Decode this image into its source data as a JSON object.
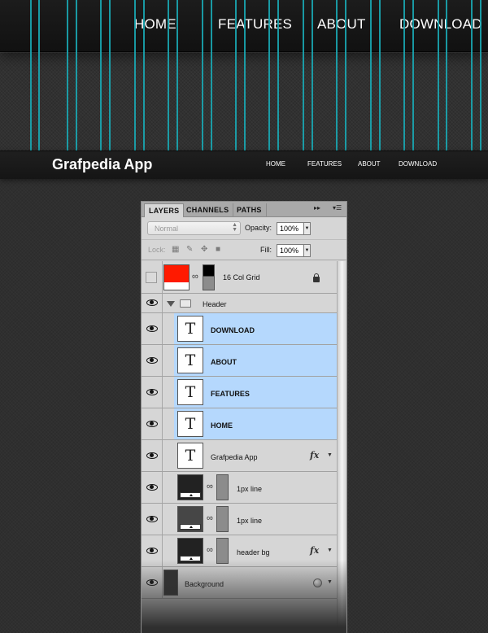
{
  "zoomed_header": {
    "nav": [
      "HOME",
      "FEATURES",
      "ABOUT",
      "DOWNLOAD"
    ],
    "grid_color": "#1aa7b2"
  },
  "site_header": {
    "logo": "Grafpedia App",
    "nav": [
      "HOME",
      "FEATURES",
      "ABOUT",
      "DOWNLOAD"
    ]
  },
  "panel": {
    "tabs": [
      "LAYERS",
      "CHANNELS",
      "PATHS"
    ],
    "blend_mode": "Normal",
    "opacity_label": "Opacity:",
    "opacity": "100%",
    "lock_label": "Lock:",
    "fill_label": "Fill:",
    "fill": "100%",
    "layers": [
      {
        "name": "16 Col Grid",
        "color": "#ff1a00"
      },
      {
        "name": "Header"
      },
      {
        "name": "DOWNLOAD"
      },
      {
        "name": "ABOUT"
      },
      {
        "name": "FEATURES"
      },
      {
        "name": "HOME"
      },
      {
        "name": "Grafpedia App",
        "fx": "fx"
      },
      {
        "name": "1px line"
      },
      {
        "name": "1px line"
      },
      {
        "name": "header bg",
        "fx": "fx"
      },
      {
        "name": "Background"
      }
    ]
  },
  "icons": {
    "eye": "eye-icon",
    "type": "T"
  },
  "selection_color": "#b5d8fd"
}
